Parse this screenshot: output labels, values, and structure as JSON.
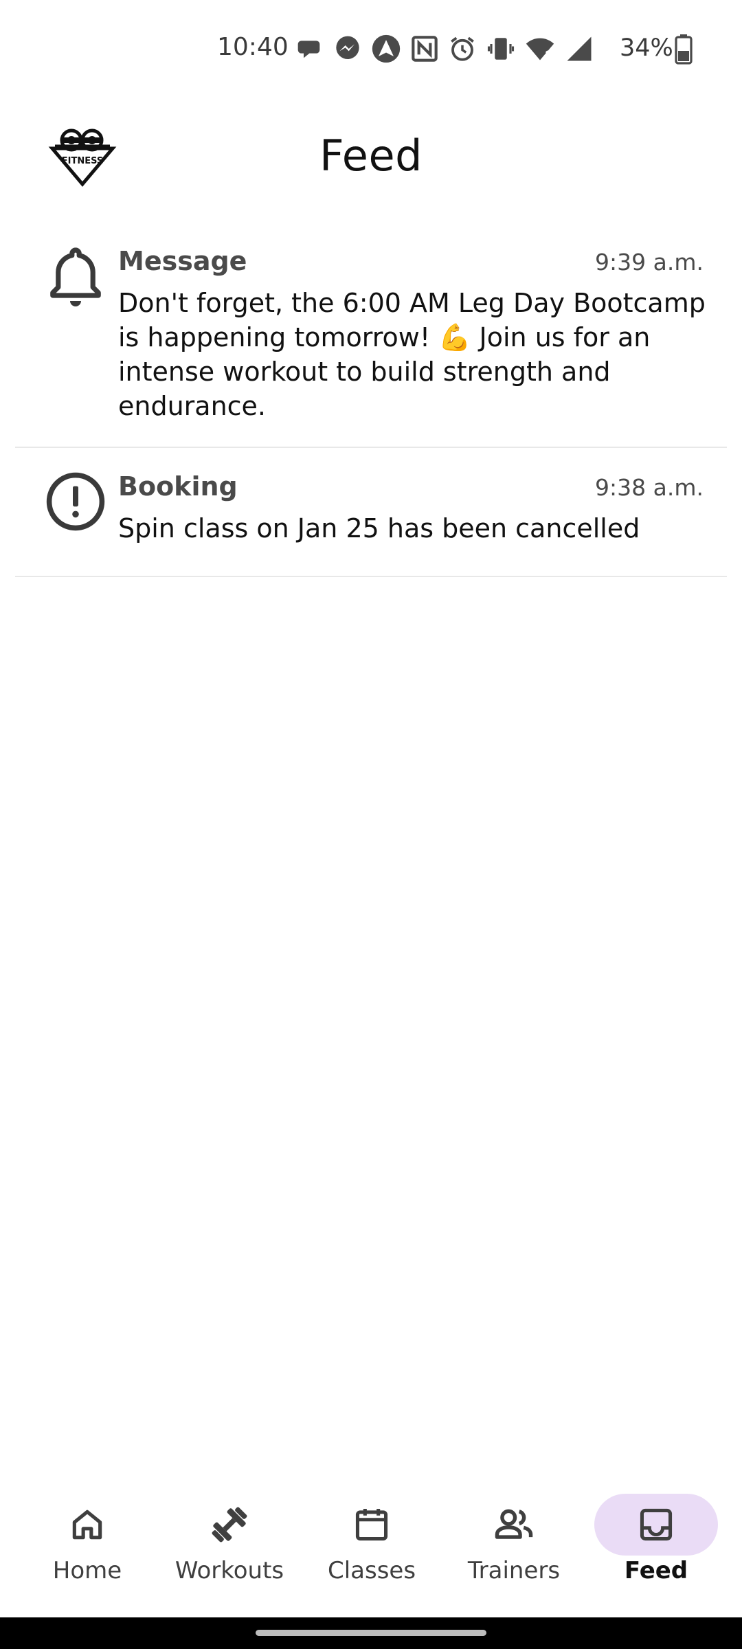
{
  "status_bar": {
    "time": "10:40",
    "battery": "34%",
    "icons": [
      "chat-bubble-icon",
      "messenger-icon",
      "navigation-icon",
      "nfc-icon",
      "alarm-icon",
      "vibrate-icon",
      "wifi-icon",
      "signal-icon",
      "battery-icon"
    ]
  },
  "header": {
    "title": "Feed",
    "logo_text": "FITNESS",
    "logo": "fitness-logo"
  },
  "feed": {
    "items": [
      {
        "type": "Message",
        "time": "9:39 a.m.",
        "icon": "bell-icon",
        "body": "Don't forget, the 6:00 AM Leg Day Bootcamp is happening tomorrow! 💪 Join us for an intense workout to build strength and endurance."
      },
      {
        "type": "Booking",
        "time": "9:38 a.m.",
        "icon": "alert-circle-icon",
        "body": "Spin class on Jan 25 has been cancelled"
      }
    ]
  },
  "bottom_nav": {
    "items": [
      {
        "label": "Home",
        "icon": "home-icon",
        "active": false
      },
      {
        "label": "Workouts",
        "icon": "dumbbell-icon",
        "active": false
      },
      {
        "label": "Classes",
        "icon": "calendar-icon",
        "active": false
      },
      {
        "label": "Trainers",
        "icon": "people-icon",
        "active": false
      },
      {
        "label": "Feed",
        "icon": "inbox-icon",
        "active": true
      }
    ],
    "active_highlight_color": "#eadcf6"
  }
}
